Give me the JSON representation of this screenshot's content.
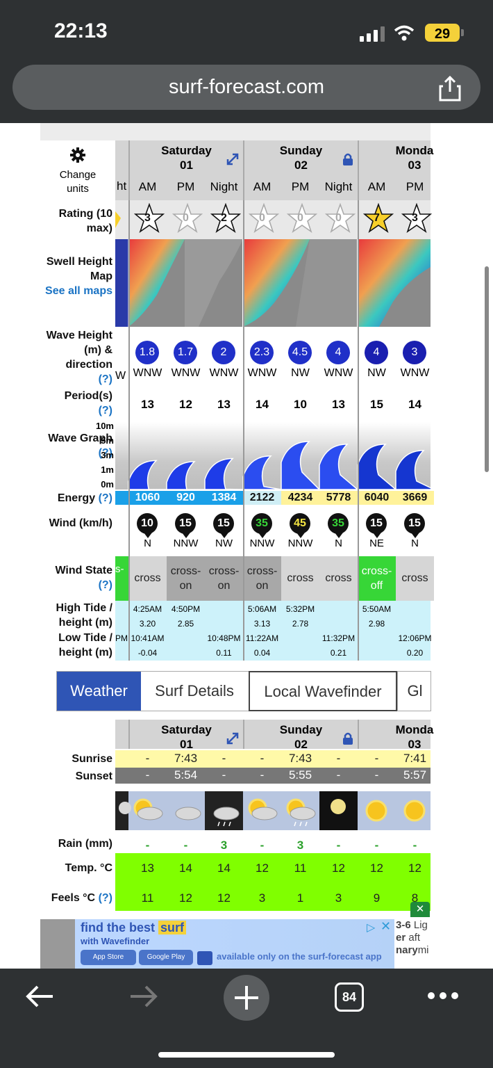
{
  "status": {
    "time": "22:13",
    "battery": "29"
  },
  "browser": {
    "url": "surf-forecast.com",
    "tabs_count": "84"
  },
  "units": {
    "label": "Change units"
  },
  "days": [
    {
      "name": "Saturday",
      "num": "01"
    },
    {
      "name": "Sunday",
      "num": "02"
    },
    {
      "name": "Monda",
      "num": "03"
    }
  ],
  "periods": [
    "AM",
    "PM",
    "Night",
    "AM",
    "PM",
    "Night",
    "AM",
    "PM"
  ],
  "partial_period": "ht",
  "labels": {
    "rating": "Rating (10 max)",
    "swell_map": "Swell Height Map",
    "see_all": "See all maps",
    "wave_height": "Wave Height (m) & direction",
    "q": "(?)",
    "period": "Period(s)",
    "wave_graph": "Wave Graph",
    "energy": "Energy",
    "wind": "Wind (km/h)",
    "wind_state": "Wind State",
    "high_tide": "High Tide / height (m)",
    "low_tide": "Low Tide / height (m)"
  },
  "ratings": [
    "3",
    "0",
    "2",
    "0",
    "0",
    "0",
    "7",
    "3"
  ],
  "wave_heights": [
    "1.8",
    "1.7",
    "2",
    "2.3",
    "4.5",
    "4",
    "4",
    "3"
  ],
  "wave_dirs": [
    "WNW",
    "WNW",
    "WNW",
    "WNW",
    "NW",
    "WNW",
    "NW",
    "WNW"
  ],
  "partial_dir": "W",
  "periods_s": [
    "13",
    "12",
    "13",
    "14",
    "10",
    "13",
    "15",
    "14"
  ],
  "graph_scale": [
    "10m",
    "5m",
    "3m",
    "1m",
    "0m"
  ],
  "energy": [
    "1060",
    "920",
    "1384",
    "2122",
    "4234",
    "5778",
    "6040",
    "3669"
  ],
  "wind_speeds": [
    "10",
    "15",
    "15",
    "35",
    "45",
    "35",
    "15",
    "15"
  ],
  "wind_dirs": [
    "N",
    "NNW",
    "NW",
    "NNW",
    "NNW",
    "N",
    "NE",
    "N"
  ],
  "wind_states": [
    "cross",
    "cross-on",
    "cross-on",
    "cross-on",
    "cross",
    "cross",
    "cross-off",
    "cross"
  ],
  "partial_state": "s-",
  "high_tides": [
    {
      "time": "4:25AM",
      "h": "3.20"
    },
    {
      "time": "4:50PM",
      "h": "2.85"
    },
    {
      "time": "5:06AM",
      "h": "3.13"
    },
    {
      "time": "5:32PM",
      "h": "2.78"
    },
    {
      "time": "5:50AM",
      "h": "2.98"
    }
  ],
  "low_tides": [
    {
      "time": "10:41AM",
      "h": "-0.04"
    },
    {
      "time": "10:48PM",
      "h": "0.11"
    },
    {
      "time": "11:22AM",
      "h": "0.04"
    },
    {
      "time": "11:32PM",
      "h": "0.21"
    },
    {
      "time": "12:06PM",
      "h": "0.20"
    }
  ],
  "partial_low": "PM",
  "nav_tabs": [
    "Weather",
    "Surf Details",
    "Local Wavefinder",
    "Gl"
  ],
  "weather": {
    "sunrise_label": "Sunrise",
    "sunset_label": "Sunset",
    "rain_label": "Rain (mm)",
    "temp_label": "Temp. °C",
    "feels_label": "Feels °C",
    "sunrise": [
      "-",
      "7:43",
      "-",
      "-",
      "7:43",
      "-",
      "-",
      "7:41"
    ],
    "sunset": [
      "-",
      "5:54",
      "-",
      "-",
      "5:55",
      "-",
      "-",
      "5:57"
    ],
    "rain": [
      "-",
      "-",
      "3",
      "-",
      "3",
      "-",
      "-",
      "-"
    ],
    "temp": [
      "13",
      "14",
      "14",
      "12",
      "11",
      "12",
      "12",
      "12"
    ],
    "feels": [
      "11",
      "12",
      "12",
      "3",
      "1",
      "3",
      "9",
      "8"
    ]
  },
  "ad": {
    "line1": "find the best",
    "line1b": "surf",
    "line2": "with Wavefinder",
    "app_store": "App Store",
    "google_play": "Google Play",
    "tagline": "available only on the surf-forecast app",
    "side1": "3-6",
    "side2": "Lig",
    "side3": "er",
    "side4": "aft",
    "side5": "nary",
    "side6": "mi"
  },
  "colors": {
    "accent": "#2f55b5",
    "wind_low": "#ffffff",
    "wind_high": "#f5e642",
    "wind_green": "#37d637"
  }
}
